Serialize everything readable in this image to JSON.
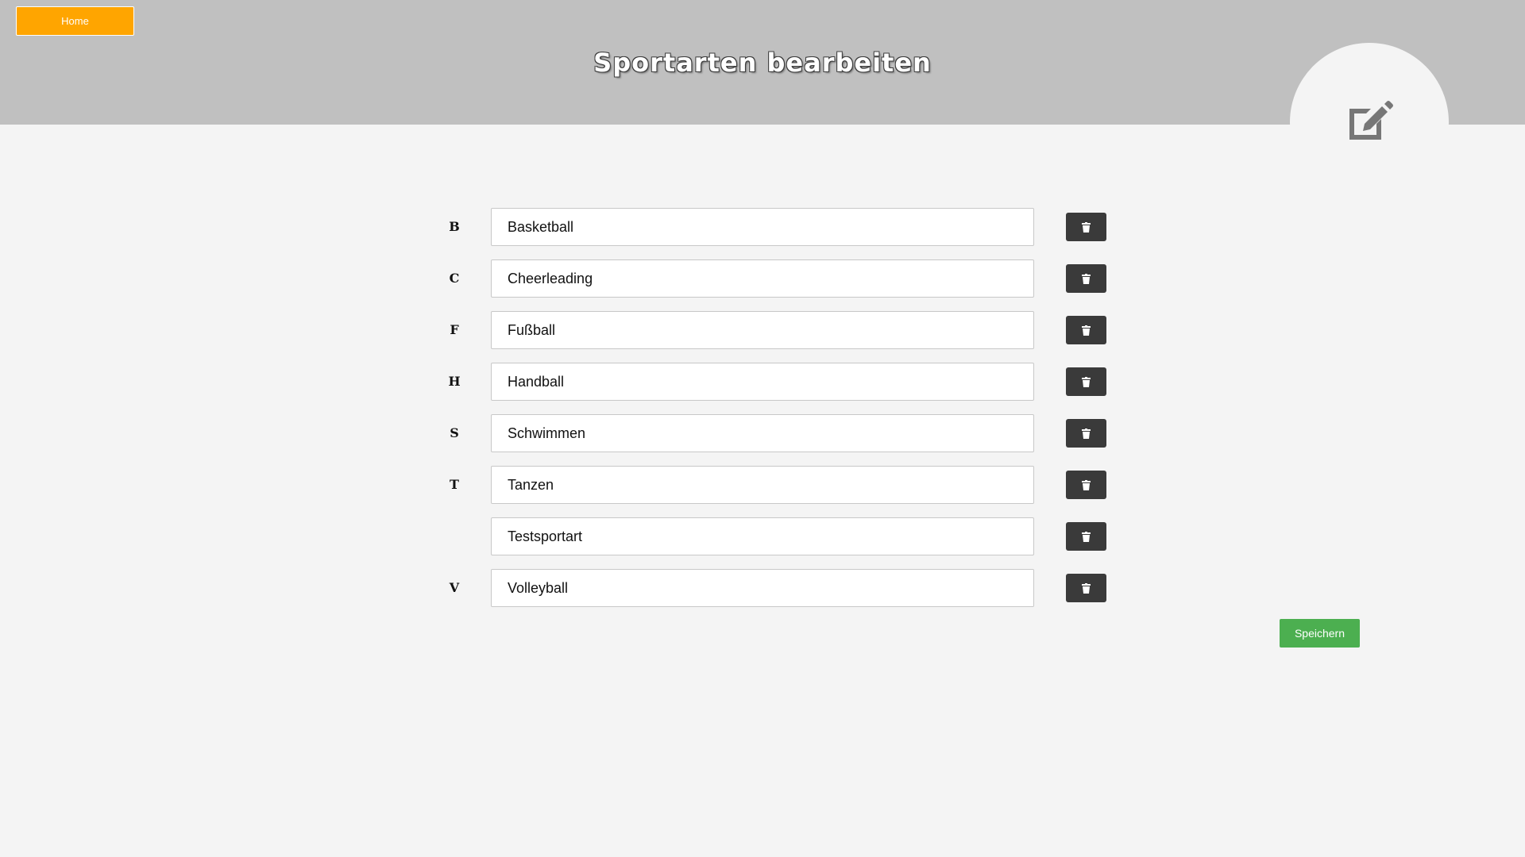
{
  "header": {
    "home_label": "Home",
    "title": "Sportarten bearbeiten",
    "edit_icon": "edit-icon"
  },
  "sports": [
    {
      "letter": "B",
      "name": "Basketball"
    },
    {
      "letter": "C",
      "name": "Cheerleading"
    },
    {
      "letter": "F",
      "name": "Fußball"
    },
    {
      "letter": "H",
      "name": "Handball"
    },
    {
      "letter": "S",
      "name": "Schwimmen"
    },
    {
      "letter": "T",
      "name": "Tanzen"
    },
    {
      "letter": "",
      "name": "Testsportart"
    },
    {
      "letter": "V",
      "name": "Volleyball"
    }
  ],
  "delete_icon": "trash-icon",
  "save_label": "Speichern",
  "colors": {
    "header_bg": "#c0c0c0",
    "page_bg": "#f4f4f4",
    "home_button": "#ffa500",
    "delete_button": "#3a3a3a",
    "save_button": "#4caf50"
  }
}
